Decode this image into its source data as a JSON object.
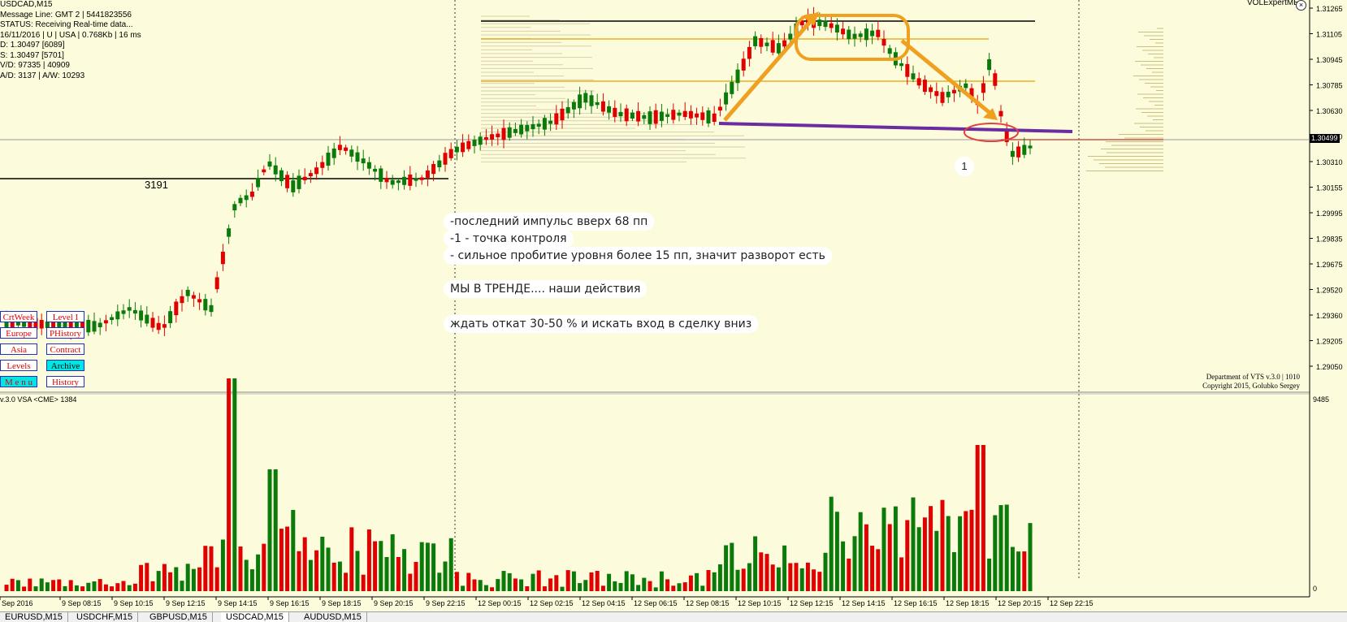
{
  "info_lines": [
    "USDCAD,M15",
    "Message Line: GMT 2 | 5441823556",
    "STATUS:  Receiving Real-time data...",
    "16/11/2016 | U | USA | 0.768Kb | 16 ms",
    "D: 1.30497  [6089]",
    "S: 1.30497  [5701]",
    "V/D: 97335 | 40909",
    "A/D: 3137 | A/W: 10293"
  ],
  "indicator_name": "VOLExpertME",
  "level_label": "3191",
  "point_label": "1",
  "annotations": [
    "-последний импульс вверх 68 пп",
    "-1 - точка контроля",
    "- сильное пробитие уровня более 15 пп, значит разворот есть",
    "МЫ В ТРЕНДЕ.... наши действия",
    "ждать откат 30-50 % и искать вход в сделку вниз"
  ],
  "buttons": [
    {
      "label": "CrtWeek",
      "style": "white"
    },
    {
      "label": "Level I",
      "style": "white"
    },
    {
      "label": "Europe",
      "style": "white"
    },
    {
      "label": "PHistory",
      "style": "white"
    },
    {
      "label": "Asia",
      "style": "white"
    },
    {
      "label": "Contract",
      "style": "white"
    },
    {
      "label": "Levels",
      "style": "white"
    },
    {
      "label": "Archive",
      "style": "cyan"
    },
    {
      "label": "M e n u",
      "style": "cyanr"
    },
    {
      "label": "History",
      "style": "white"
    }
  ],
  "price_axis": [
    "1.31265",
    "1.31105",
    "1.30945",
    "1.30785",
    "1.30630",
    "1.30470",
    "1.30310",
    "1.30155",
    "1.29995",
    "1.29835",
    "1.29675",
    "1.29520",
    "1.29360",
    "1.29205",
    "1.29050"
  ],
  "current_price": "1.30499",
  "copyright_lines": [
    "Department of VTS  v.3.0 | 1010",
    "Copyright 2015, Golubko Sergey"
  ],
  "vsa_label": "v.3.0 VSA <CME> 1384",
  "volume_axis": {
    "top": "9485",
    "bottom": "0"
  },
  "time_axis": [
    "Sep 2016",
    "9 Sep 08:15",
    "9 Sep 10:15",
    "9 Sep 12:15",
    "9 Sep 14:15",
    "9 Sep 16:15",
    "9 Sep 18:15",
    "9 Sep 20:15",
    "9 Sep 22:15",
    "12 Sep 00:15",
    "12 Sep 02:15",
    "12 Sep 04:15",
    "12 Sep 06:15",
    "12 Sep 08:15",
    "12 Sep 10:15",
    "12 Sep 12:15",
    "12 Sep 14:15",
    "12 Sep 16:15",
    "12 Sep 18:15",
    "12 Sep 20:15",
    "12 Sep 22:15"
  ],
  "tabs": [
    {
      "label": "EURUSD,M15",
      "active": false
    },
    {
      "label": "USDCHF,M15",
      "active": false
    },
    {
      "label": "GBPUSD,M15",
      "active": false
    },
    {
      "label": "USDCAD,M15",
      "active": true
    },
    {
      "label": "AUDUSD,M15",
      "active": false
    }
  ],
  "colors": {
    "bg": "#fcfcdc",
    "up": "#0a7a0a",
    "down": "#e00000",
    "level": "#e6a000",
    "trend": "#6a2ca0",
    "arrow": "#f0a020"
  }
}
